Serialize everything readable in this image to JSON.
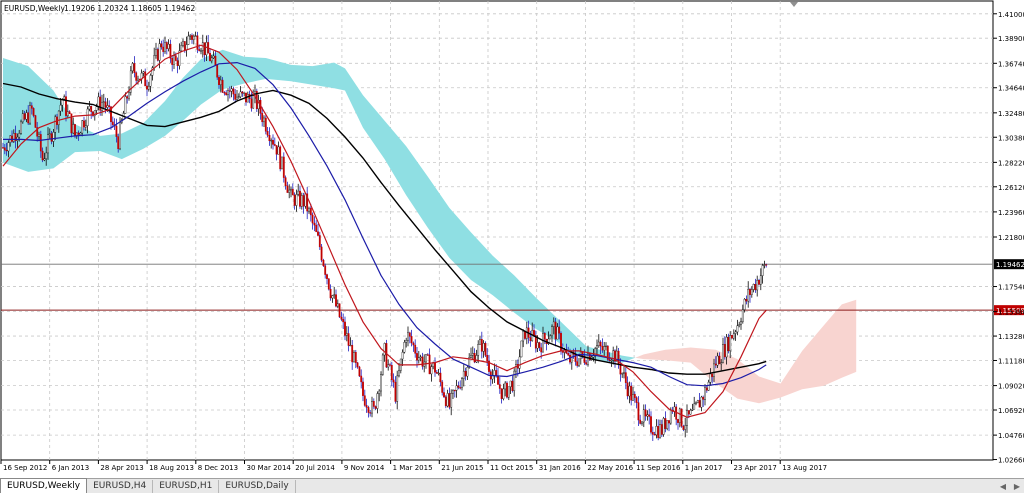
{
  "window": {
    "title": "EURUSD,Weekly",
    "ohlc_text": "1.19206 1.20324 1.18605 1.19462"
  },
  "tabs": [
    {
      "label": "EURUSD,Weekly",
      "active": true
    },
    {
      "label": "EURUSD,H4",
      "active": false
    },
    {
      "label": "EURUSD,H1",
      "active": false
    },
    {
      "label": "EURUSD,Daily",
      "active": false
    }
  ],
  "colors": {
    "bull": "#0a0a0a",
    "bear": "#c00000",
    "bear_body": "#2020c0",
    "ema_fast": "#c0161d",
    "ema_mid": "#1c1ca8",
    "ma_slow": "#000000",
    "cloud_bull": "#8fdfe3",
    "cloud_bear": "#f8d4d0",
    "hline": "#8b1a1a",
    "current_price_bg": "#000000",
    "hline_label_bg": "#c00000"
  },
  "chart_data": {
    "type": "line",
    "symbol": "EURUSD",
    "timeframe": "Weekly",
    "ylim": [
      1.0262,
      1.421
    ],
    "y_ticks": [
      "1.41000",
      "1.38900",
      "1.36740",
      "1.34640",
      "1.32480",
      "1.30380",
      "1.28220",
      "1.26120",
      "1.23960",
      "1.21800",
      "1.17540",
      "1.15380",
      "1.13280",
      "1.11180",
      "1.09020",
      "1.06920",
      "1.04760",
      "1.02660"
    ],
    "x_ticks": [
      "16 Sep 2012",
      "6 Jan 2013",
      "28 Apr 2013",
      "18 Aug 2013",
      "8 Dec 2013",
      "30 Mar 2014",
      "20 Jul 2014",
      "9 Nov 2014",
      "1 Mar 2015",
      "21 Jun 2015",
      "11 Oct 2015",
      "31 Jan 2016",
      "22 May 2016",
      "11 Sep 2016",
      "1 Jan 2017",
      "23 Apr 2017",
      "13 Aug 2017"
    ],
    "current_price": {
      "value": 1.19462,
      "label": "1.19462"
    },
    "horizontal_line": {
      "value": 1.15509,
      "label": "1.15509"
    },
    "price_path": [
      [
        0,
        1.295
      ],
      [
        8,
        1.31
      ],
      [
        16,
        1.327
      ],
      [
        22,
        1.285
      ],
      [
        26,
        1.303
      ],
      [
        33,
        1.337
      ],
      [
        40,
        1.305
      ],
      [
        48,
        1.327
      ],
      [
        56,
        1.335
      ],
      [
        64,
        1.301
      ],
      [
        72,
        1.362
      ],
      [
        80,
        1.351
      ],
      [
        88,
        1.385
      ],
      [
        96,
        1.368
      ],
      [
        104,
        1.392
      ],
      [
        110,
        1.385
      ],
      [
        116,
        1.37
      ],
      [
        122,
        1.349
      ],
      [
        130,
        1.339
      ],
      [
        140,
        1.336
      ],
      [
        152,
        1.295
      ],
      [
        160,
        1.252
      ],
      [
        168,
        1.248
      ],
      [
        176,
        1.21
      ],
      [
        182,
        1.172
      ],
      [
        188,
        1.145
      ],
      [
        194,
        1.117
      ],
      [
        200,
        1.082
      ],
      [
        206,
        1.068
      ],
      [
        212,
        1.119
      ],
      [
        218,
        1.083
      ],
      [
        224,
        1.135
      ],
      [
        232,
        1.113
      ],
      [
        240,
        1.105
      ],
      [
        248,
        1.072
      ],
      [
        258,
        1.11
      ],
      [
        266,
        1.126
      ],
      [
        272,
        1.099
      ],
      [
        278,
        1.083
      ],
      [
        284,
        1.095
      ],
      [
        290,
        1.137
      ],
      [
        298,
        1.125
      ],
      [
        306,
        1.14
      ],
      [
        314,
        1.112
      ],
      [
        322,
        1.114
      ],
      [
        330,
        1.123
      ],
      [
        340,
        1.117
      ],
      [
        348,
        1.085
      ],
      [
        354,
        1.065
      ],
      [
        360,
        1.055
      ],
      [
        366,
        1.052
      ],
      [
        372,
        1.072
      ],
      [
        378,
        1.058
      ],
      [
        384,
        1.067
      ],
      [
        390,
        1.085
      ],
      [
        396,
        1.11
      ],
      [
        402,
        1.125
      ],
      [
        408,
        1.143
      ],
      [
        414,
        1.168
      ],
      [
        420,
        1.183
      ],
      [
        424,
        1.195
      ]
    ],
    "ema_fast_line": [
      [
        0,
        1.279
      ],
      [
        10,
        1.298
      ],
      [
        20,
        1.312
      ],
      [
        30,
        1.318
      ],
      [
        40,
        1.322
      ],
      [
        50,
        1.323
      ],
      [
        60,
        1.328
      ],
      [
        70,
        1.344
      ],
      [
        80,
        1.358
      ],
      [
        90,
        1.371
      ],
      [
        100,
        1.378
      ],
      [
        110,
        1.383
      ],
      [
        120,
        1.377
      ],
      [
        130,
        1.362
      ],
      [
        140,
        1.339
      ],
      [
        150,
        1.313
      ],
      [
        160,
        1.283
      ],
      [
        170,
        1.249
      ],
      [
        180,
        1.213
      ],
      [
        190,
        1.177
      ],
      [
        200,
        1.145
      ],
      [
        210,
        1.122
      ],
      [
        220,
        1.108
      ],
      [
        230,
        1.108
      ],
      [
        240,
        1.11
      ],
      [
        250,
        1.115
      ],
      [
        260,
        1.113
      ],
      [
        270,
        1.11
      ],
      [
        280,
        1.103
      ],
      [
        290,
        1.11
      ],
      [
        300,
        1.116
      ],
      [
        310,
        1.12
      ],
      [
        320,
        1.12
      ],
      [
        330,
        1.117
      ],
      [
        340,
        1.113
      ],
      [
        350,
        1.102
      ],
      [
        360,
        1.085
      ],
      [
        370,
        1.07
      ],
      [
        380,
        1.063
      ],
      [
        390,
        1.067
      ],
      [
        400,
        1.085
      ],
      [
        410,
        1.115
      ],
      [
        420,
        1.148
      ],
      [
        424,
        1.155
      ]
    ],
    "ema_mid_line": [
      [
        0,
        1.302
      ],
      [
        10,
        1.302
      ],
      [
        20,
        1.301
      ],
      [
        30,
        1.303
      ],
      [
        40,
        1.305
      ],
      [
        50,
        1.306
      ],
      [
        60,
        1.312
      ],
      [
        70,
        1.322
      ],
      [
        80,
        1.333
      ],
      [
        90,
        1.343
      ],
      [
        100,
        1.352
      ],
      [
        110,
        1.36
      ],
      [
        120,
        1.367
      ],
      [
        130,
        1.368
      ],
      [
        140,
        1.363
      ],
      [
        150,
        1.349
      ],
      [
        160,
        1.329
      ],
      [
        170,
        1.305
      ],
      [
        180,
        1.279
      ],
      [
        190,
        1.25
      ],
      [
        200,
        1.217
      ],
      [
        210,
        1.185
      ],
      [
        220,
        1.16
      ],
      [
        230,
        1.14
      ],
      [
        240,
        1.126
      ],
      [
        250,
        1.113
      ],
      [
        260,
        1.106
      ],
      [
        270,
        1.099
      ],
      [
        280,
        1.098
      ],
      [
        290,
        1.102
      ],
      [
        300,
        1.106
      ],
      [
        310,
        1.111
      ],
      [
        320,
        1.117
      ],
      [
        330,
        1.116
      ],
      [
        340,
        1.113
      ],
      [
        350,
        1.11
      ],
      [
        360,
        1.106
      ],
      [
        370,
        1.098
      ],
      [
        380,
        1.091
      ],
      [
        390,
        1.09
      ],
      [
        400,
        1.092
      ],
      [
        410,
        1.097
      ],
      [
        420,
        1.104
      ],
      [
        424,
        1.108
      ]
    ],
    "ma_slow_line": [
      [
        0,
        1.35
      ],
      [
        10,
        1.347
      ],
      [
        20,
        1.341
      ],
      [
        30,
        1.337
      ],
      [
        40,
        1.334
      ],
      [
        50,
        1.332
      ],
      [
        60,
        1.326
      ],
      [
        70,
        1.32
      ],
      [
        80,
        1.314
      ],
      [
        90,
        1.313
      ],
      [
        100,
        1.317
      ],
      [
        110,
        1.321
      ],
      [
        120,
        1.326
      ],
      [
        130,
        1.335
      ],
      [
        140,
        1.341
      ],
      [
        150,
        1.344
      ],
      [
        160,
        1.34
      ],
      [
        170,
        1.333
      ],
      [
        180,
        1.32
      ],
      [
        190,
        1.304
      ],
      [
        200,
        1.286
      ],
      [
        210,
        1.265
      ],
      [
        220,
        1.245
      ],
      [
        230,
        1.226
      ],
      [
        240,
        1.207
      ],
      [
        250,
        1.189
      ],
      [
        260,
        1.171
      ],
      [
        270,
        1.157
      ],
      [
        280,
        1.145
      ],
      [
        290,
        1.137
      ],
      [
        300,
        1.129
      ],
      [
        310,
        1.123
      ],
      [
        320,
        1.116
      ],
      [
        330,
        1.112
      ],
      [
        340,
        1.109
      ],
      [
        350,
        1.106
      ],
      [
        360,
        1.104
      ],
      [
        370,
        1.101
      ],
      [
        380,
        1.1
      ],
      [
        390,
        1.1
      ],
      [
        400,
        1.103
      ],
      [
        410,
        1.106
      ],
      [
        420,
        1.109
      ],
      [
        424,
        1.111
      ]
    ],
    "cloud": [
      {
        "t": 0,
        "a": 1.372,
        "b": 1.282
      },
      {
        "t": 14,
        "a": 1.365,
        "b": 1.274
      },
      {
        "t": 28,
        "a": 1.344,
        "b": 1.277
      },
      {
        "t": 40,
        "a": 1.315,
        "b": 1.291
      },
      {
        "t": 54,
        "a": 1.305,
        "b": 1.292
      },
      {
        "t": 66,
        "a": 1.307,
        "b": 1.285
      },
      {
        "t": 78,
        "a": 1.316,
        "b": 1.294
      },
      {
        "t": 90,
        "a": 1.335,
        "b": 1.305
      },
      {
        "t": 100,
        "a": 1.355,
        "b": 1.318
      },
      {
        "t": 110,
        "a": 1.371,
        "b": 1.332
      },
      {
        "t": 122,
        "a": 1.379,
        "b": 1.345
      },
      {
        "t": 134,
        "a": 1.373,
        "b": 1.35
      },
      {
        "t": 146,
        "a": 1.372,
        "b": 1.354
      },
      {
        "t": 160,
        "a": 1.366,
        "b": 1.352
      },
      {
        "t": 172,
        "a": 1.365,
        "b": 1.349
      },
      {
        "t": 184,
        "a": 1.368,
        "b": 1.346
      },
      {
        "t": 190,
        "a": 1.363,
        "b": 1.344
      },
      {
        "t": 200,
        "a": 1.34,
        "b": 1.312
      },
      {
        "t": 212,
        "a": 1.318,
        "b": 1.285
      },
      {
        "t": 224,
        "a": 1.296,
        "b": 1.254
      },
      {
        "t": 236,
        "a": 1.27,
        "b": 1.226
      },
      {
        "t": 248,
        "a": 1.243,
        "b": 1.2
      },
      {
        "t": 260,
        "a": 1.222,
        "b": 1.181
      },
      {
        "t": 272,
        "a": 1.202,
        "b": 1.168
      },
      {
        "t": 284,
        "a": 1.185,
        "b": 1.153
      },
      {
        "t": 296,
        "a": 1.166,
        "b": 1.139
      },
      {
        "t": 308,
        "a": 1.148,
        "b": 1.128
      },
      {
        "t": 316,
        "a": 1.136,
        "b": 1.118
      },
      {
        "t": 324,
        "a": 1.124,
        "b": 1.113
      },
      {
        "t": 334,
        "a": 1.12,
        "b": 1.111
      },
      {
        "t": 344,
        "a": 1.116,
        "b": 1.11
      },
      {
        "t": 356,
        "a": 1.113,
        "b": 1.117
      },
      {
        "t": 368,
        "a": 1.112,
        "b": 1.121
      },
      {
        "t": 382,
        "a": 1.11,
        "b": 1.123
      },
      {
        "t": 396,
        "a": 1.092,
        "b": 1.121
      },
      {
        "t": 408,
        "a": 1.079,
        "b": 1.113
      },
      {
        "t": 420,
        "a": 1.075,
        "b": 1.098
      },
      {
        "t": 432,
        "a": 1.08,
        "b": 1.092
      },
      {
        "t": 444,
        "a": 1.087,
        "b": 1.12
      },
      {
        "t": 456,
        "a": 1.09,
        "b": 1.142
      },
      {
        "t": 466,
        "a": 1.097,
        "b": 1.16
      },
      {
        "t": 474,
        "a": 1.102,
        "b": 1.164
      }
    ]
  }
}
